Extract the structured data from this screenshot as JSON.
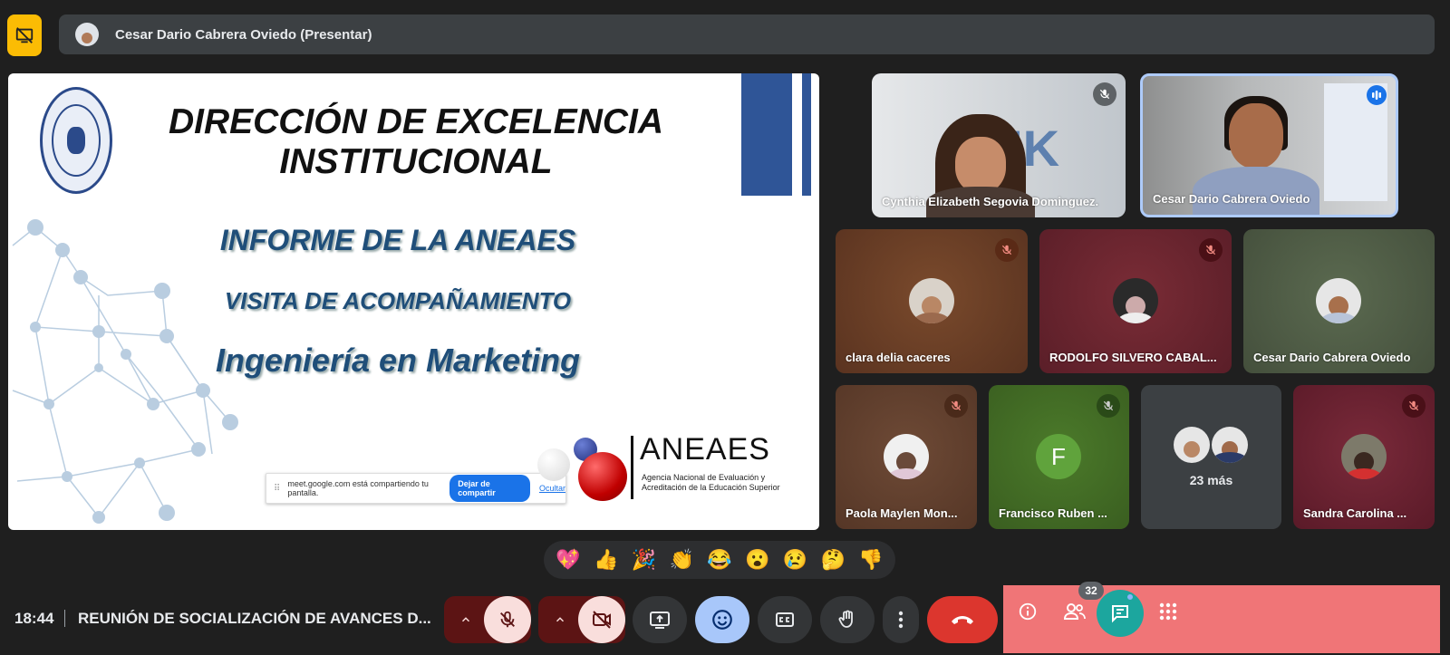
{
  "presenter_bar": {
    "name": "Cesar Dario Cabrera Oviedo (Presentar)"
  },
  "slide": {
    "title": "DIRECCIÓN DE EXCELENCIA INSTITUCIONAL",
    "line1": "INFORME DE LA ANEAES",
    "line2": "VISITA DE ACOMPAÑAMIENTO",
    "line3": "Ingeniería en Marketing",
    "share_notice": {
      "text": "meet.google.com está compartiendo tu pantalla.",
      "stop_label": "Dejar de compartir",
      "hide_label": "Ocultar"
    },
    "logo": {
      "name": "ANEAES",
      "subtitle": "Agencia Nacional de Evaluación y Acreditación de la Educación Superior"
    }
  },
  "participants": {
    "video1": {
      "name": "Cynthia Elizabeth Segovia Dominguez."
    },
    "video2": {
      "name": "Cesar Dario Cabrera Oviedo"
    },
    "tile1": {
      "name": "clara delia caceres",
      "color": "#6b3d24"
    },
    "tile2": {
      "name": "RODOLFO SILVERO CABAL...",
      "color": "#6e2630"
    },
    "tile3": {
      "name": "Cesar Dario Cabrera Oviedo",
      "color": "#4e5d45"
    },
    "tile4": {
      "name": "Paola Maylen Mon...",
      "color": "#5e4030"
    },
    "tile5": {
      "name": "Francisco Ruben ...",
      "initial": "F",
      "color": "#3d6424"
    },
    "tile6": {
      "more_label": "23 más",
      "color": "#3c4043"
    },
    "tile7": {
      "name": "Sandra Carolina ...",
      "color": "#6b2232"
    }
  },
  "reactions": [
    "💖",
    "👍",
    "🎉",
    "👏",
    "😂",
    "😮",
    "😢",
    "🤔",
    "👎"
  ],
  "bottom_bar": {
    "time": "18:44",
    "meeting_title": "REUNIÓN DE SOCIALIZACIÓN DE AVANCES D...",
    "participants_count": "32"
  }
}
